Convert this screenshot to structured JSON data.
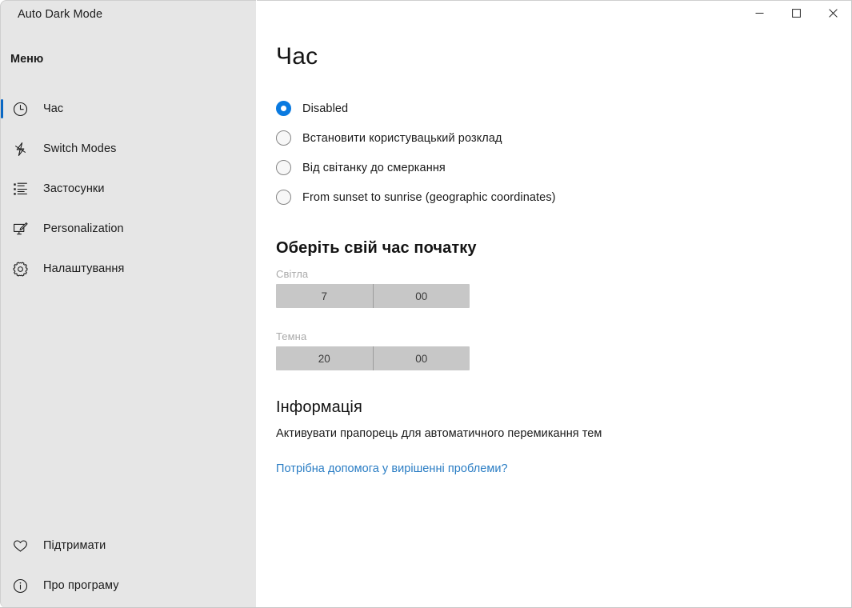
{
  "window": {
    "title": "Auto Dark Mode",
    "controls": [
      {
        "name": "minimize",
        "glyph": "minimize-icon"
      },
      {
        "name": "maximize",
        "glyph": "maximize-icon"
      },
      {
        "name": "close",
        "glyph": "close-icon"
      }
    ]
  },
  "sidebar": {
    "menu_header": "Меню",
    "accent_color": "#0a68c4",
    "background_color": "#e6e6e6",
    "items": [
      {
        "label": "Час",
        "icon": "clock-icon",
        "selected": true
      },
      {
        "label": "Switch Modes",
        "icon": "lightning-icon",
        "selected": false
      },
      {
        "label": "Застосунки",
        "icon": "apps-list-icon",
        "selected": false
      },
      {
        "label": "Personalization",
        "icon": "monitor-pencil-icon",
        "selected": false
      },
      {
        "label": "Налаштування",
        "icon": "gear-icon",
        "selected": false
      }
    ],
    "bottom_items": [
      {
        "label": "Підтримати",
        "icon": "heart-icon"
      },
      {
        "label": "Про програму",
        "icon": "info-circle-icon"
      }
    ]
  },
  "main": {
    "page_title": "Час",
    "radio_options": [
      {
        "label": "Disabled",
        "checked": true
      },
      {
        "label": "Встановити користувацький розклад",
        "checked": false
      },
      {
        "label": "Від світанку до смеркання",
        "checked": false
      },
      {
        "label": "From sunset to sunrise (geographic coordinates)",
        "checked": false
      }
    ],
    "times_section": {
      "title": "Оберіть свій час початку",
      "light": {
        "caption": "Світла",
        "hours": "7",
        "minutes": "00"
      },
      "dark": {
        "caption": "Темна",
        "hours": "20",
        "minutes": "00"
      }
    },
    "info_section": {
      "title": "Інформація",
      "text": "Активувати прапорець для автоматичного перемикання тем",
      "link": "Потрібна допомога у вирішенні проблеми?",
      "link_color": "#2a7dc4"
    }
  }
}
